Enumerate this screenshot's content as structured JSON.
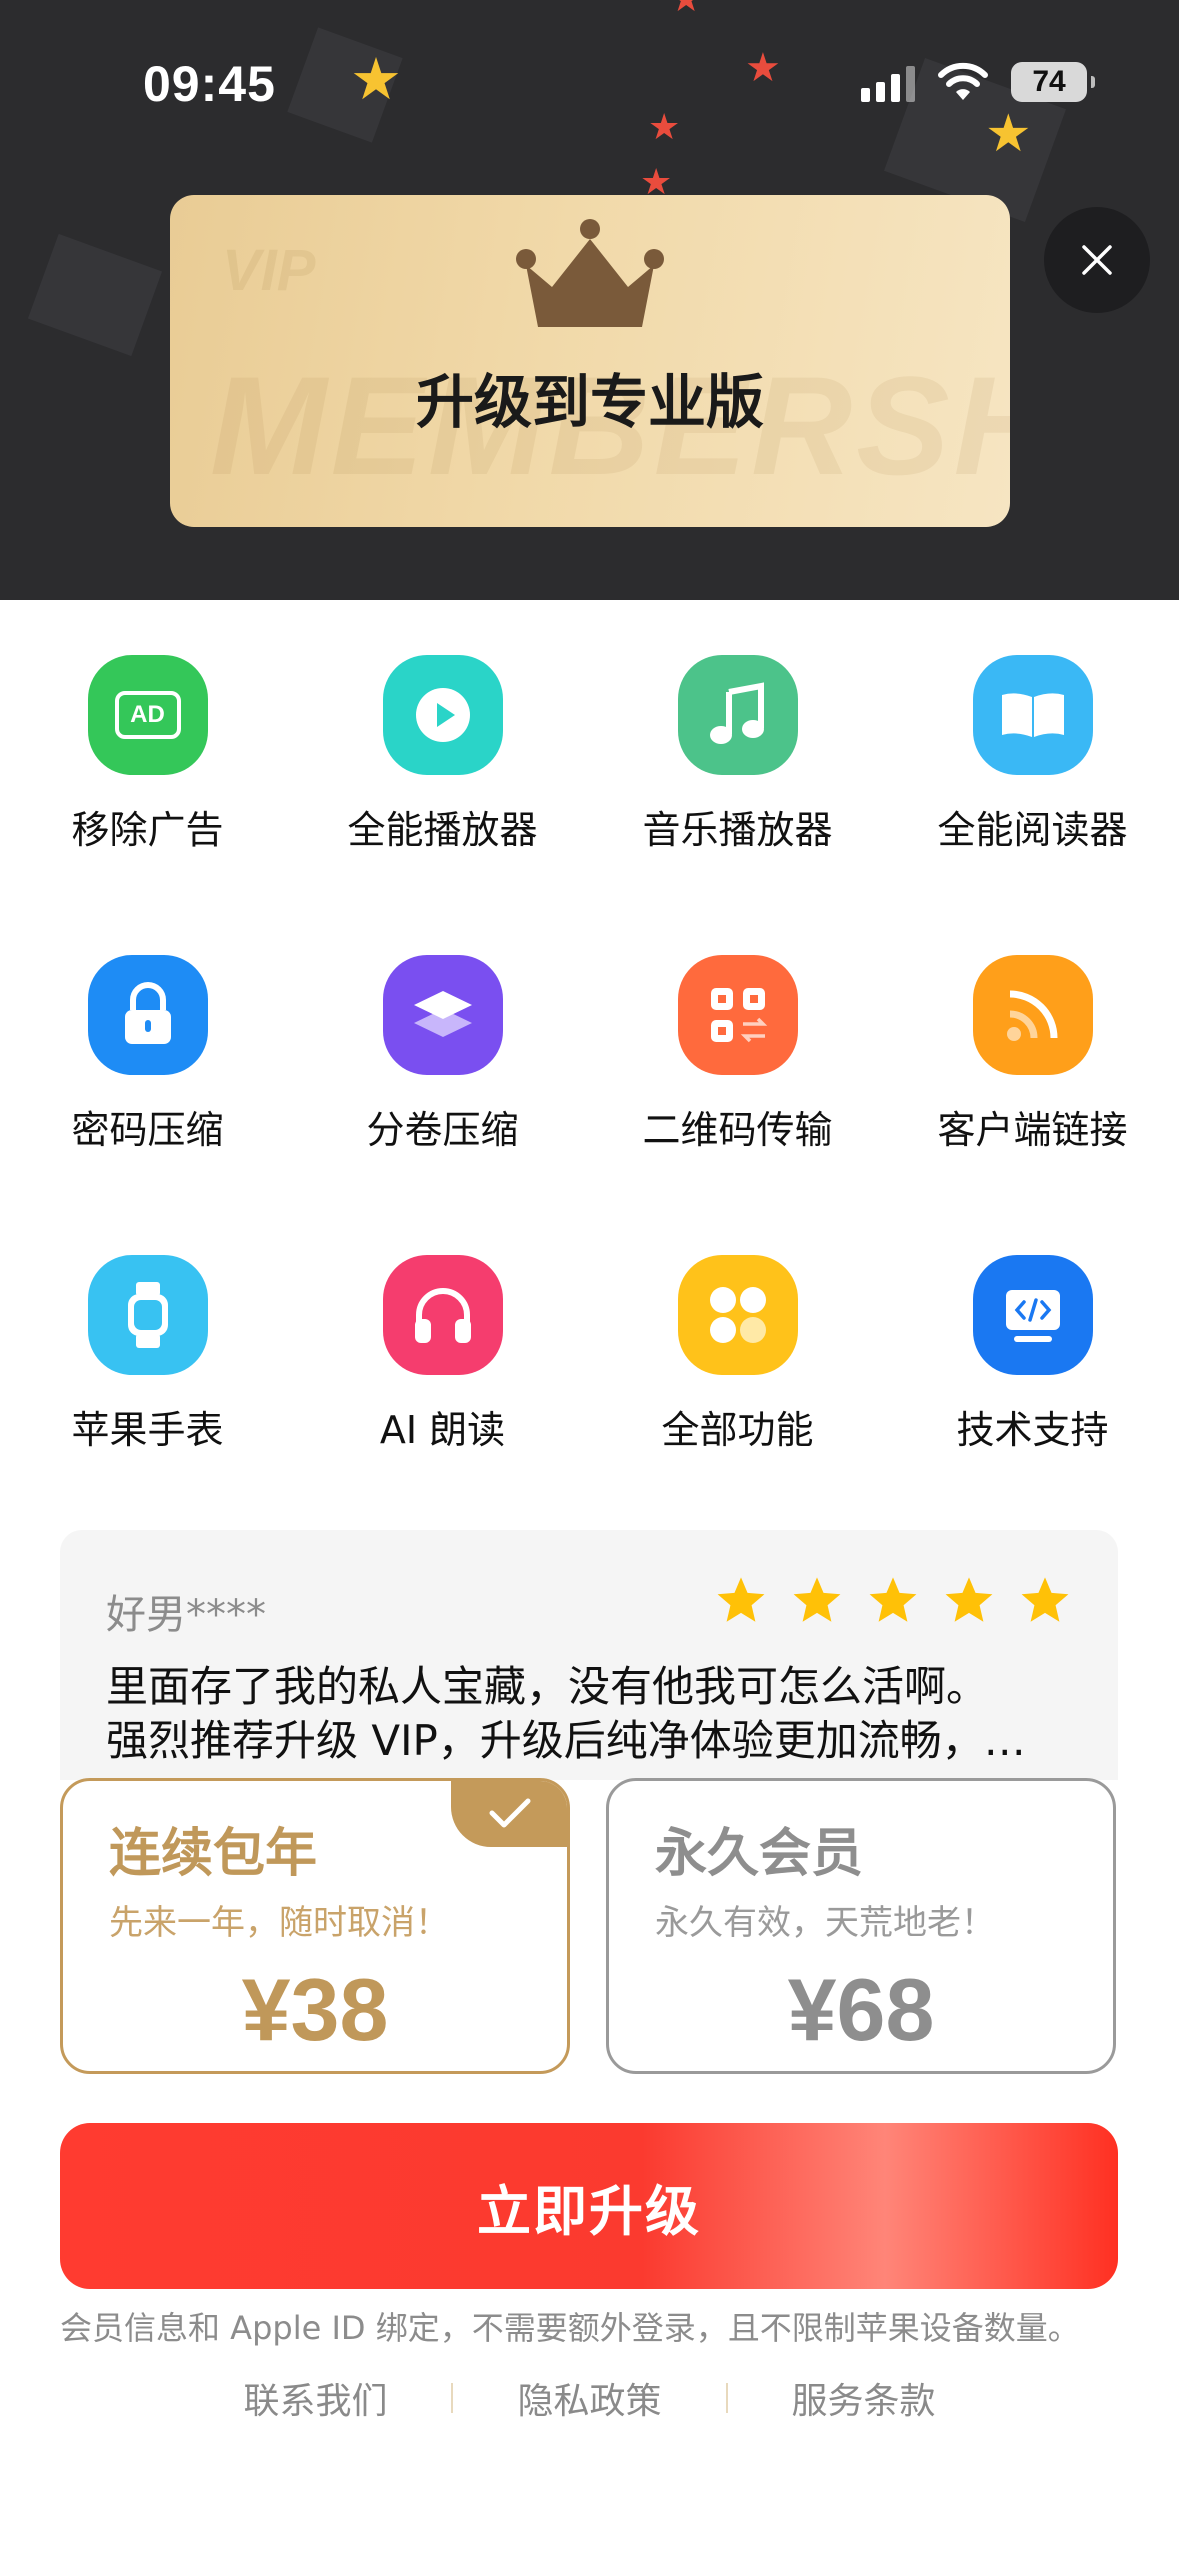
{
  "status_bar": {
    "time": "09:45",
    "battery": "74"
  },
  "banner": {
    "watermark_vip": "VIP",
    "watermark_membership": "MEMBERSHIP",
    "title": "升级到专业版"
  },
  "features": [
    {
      "label": "移除广告",
      "icon": "ad-remove-icon",
      "color": "#34c759",
      "glyph": "AD"
    },
    {
      "label": "全能播放器",
      "icon": "video-play-icon",
      "color": "#2ad4c8"
    },
    {
      "label": "音乐播放器",
      "icon": "music-note-icon",
      "color": "#4cc38a"
    },
    {
      "label": "全能阅读器",
      "icon": "book-icon",
      "color": "#3ab8f5"
    },
    {
      "label": "密码压缩",
      "icon": "lock-icon",
      "color": "#1e8cf5"
    },
    {
      "label": "分卷压缩",
      "icon": "layers-icon",
      "color": "#7a4ff0"
    },
    {
      "label": "二维码传输",
      "icon": "qr-transfer-icon",
      "color": "#ff6a3d"
    },
    {
      "label": "客户端链接",
      "icon": "rss-link-icon",
      "color": "#ff9f1a"
    },
    {
      "label": "苹果手表",
      "icon": "watch-icon",
      "color": "#38c2f2"
    },
    {
      "label": "AI 朗读",
      "icon": "headphones-icon",
      "color": "#f53d6e"
    },
    {
      "label": "全部功能",
      "icon": "all-features-icon",
      "color": "#ffc21a"
    },
    {
      "label": "技术支持",
      "icon": "code-support-icon",
      "color": "#1a78f2"
    }
  ],
  "review": {
    "user": "好男****",
    "rating": 5,
    "line1": "里面存了我的私人宝藏，没有他我可怎么活啊。",
    "line2": "强烈推荐升级 VIP，升级后纯净体验更加流畅，…"
  },
  "plans": [
    {
      "name": "连续包年",
      "desc": "先来一年，随时取消！",
      "price": "¥38",
      "selected": true
    },
    {
      "name": "永久会员",
      "desc": "永久有效，天荒地老！",
      "price": "¥68",
      "selected": false
    }
  ],
  "cta": {
    "label": "立即升级"
  },
  "note": "会员信息和 Apple ID 绑定，不需要额外登录，且不限制苹果设备数量。",
  "links": {
    "contact": "联系我们",
    "privacy": "隐私政策",
    "terms": "服务条款"
  },
  "colors": {
    "accent_red": "#ff3b30",
    "gold": "#c49a5a",
    "star": "#ffc107"
  }
}
